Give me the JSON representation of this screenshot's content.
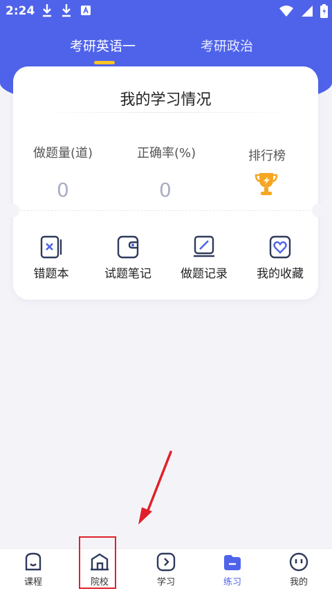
{
  "status_bar": {
    "time": "2:24"
  },
  "tabs": [
    {
      "label": "考研英语一",
      "active": true
    },
    {
      "label": "考研政治",
      "active": false
    }
  ],
  "card": {
    "title": "我的学习情况",
    "stats": [
      {
        "label": "做题量(道)",
        "value": "0"
      },
      {
        "label": "正确率(%)",
        "value": "0"
      },
      {
        "label": "排行榜",
        "icon": "trophy-icon"
      }
    ],
    "tools": [
      {
        "label": "错题本",
        "icon": "wrong-book-icon"
      },
      {
        "label": "试题笔记",
        "icon": "note-icon"
      },
      {
        "label": "做题记录",
        "icon": "record-icon"
      },
      {
        "label": "我的收藏",
        "icon": "favorite-icon"
      }
    ]
  },
  "bottom_nav": [
    {
      "label": "课程",
      "icon": "course-icon",
      "active": false
    },
    {
      "label": "院校",
      "icon": "school-icon",
      "active": false
    },
    {
      "label": "学习",
      "icon": "study-icon",
      "active": false
    },
    {
      "label": "练习",
      "icon": "practice-icon",
      "active": true
    },
    {
      "label": "我的",
      "icon": "profile-icon",
      "active": false
    }
  ],
  "colors": {
    "primary": "#4f63ea",
    "tab_indicator": "#ffc524",
    "trophy": "#f5a623",
    "annotation": "#e0202a"
  }
}
